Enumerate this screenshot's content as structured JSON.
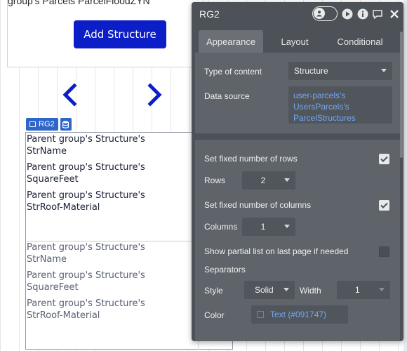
{
  "canvas": {
    "top_group_title": "group's Parcels ParcelFloodZYN",
    "add_button_label": "Add Structure",
    "prev_arrow_icon": "chevron-left-icon",
    "next_arrow_icon": "chevron-right-icon",
    "rg_tag_label": "RG2",
    "rg_tag_icon": "database-icon",
    "brand_button_color": "#0b1ec7",
    "arrow_color": "#0b1ec7",
    "cell_first": [
      "Parent group's Structure's",
      "StrName",
      "Parent group's Structure's",
      "SquareFeet",
      "Parent group's Structure's",
      "StrRoof-Material"
    ],
    "cell_second": [
      "Parent group's Structure's",
      "StrName",
      "Parent group's Structure's",
      "SquareFeet",
      "Parent group's Structure's",
      "StrRoof-Material"
    ]
  },
  "panel": {
    "title": "RG2",
    "header_icons": [
      "user-toggle-icon",
      "play-icon",
      "info-icon",
      "comment-icon",
      "close-icon"
    ],
    "tabs": [
      {
        "label": "Appearance",
        "active": true
      },
      {
        "label": "Layout",
        "active": false
      },
      {
        "label": "Conditional",
        "active": false
      }
    ],
    "type_of_content_label": "Type of content",
    "type_of_content_value": "Structure",
    "data_source_label": "Data source",
    "data_source_lines": [
      "user-parcels's",
      "UsersParcels's",
      "ParcelStructures"
    ],
    "fixed_rows_label": "Set fixed number of rows",
    "fixed_rows_checked": true,
    "rows_label": "Rows",
    "rows_value": "2",
    "fixed_cols_label": "Set fixed number of columns",
    "fixed_cols_checked": true,
    "columns_label": "Columns",
    "columns_value": "1",
    "partial_list_label": "Show partial list on last page if needed",
    "partial_list_checked": false,
    "separators_label": "Separators",
    "style_label": "Style",
    "style_value": "Solid",
    "width_label": "Width",
    "width_value": "1",
    "color_label": "Color",
    "color_value": "Text (#091747)",
    "link_color": "#74a7f0",
    "panel_bg": "#4d5258"
  }
}
